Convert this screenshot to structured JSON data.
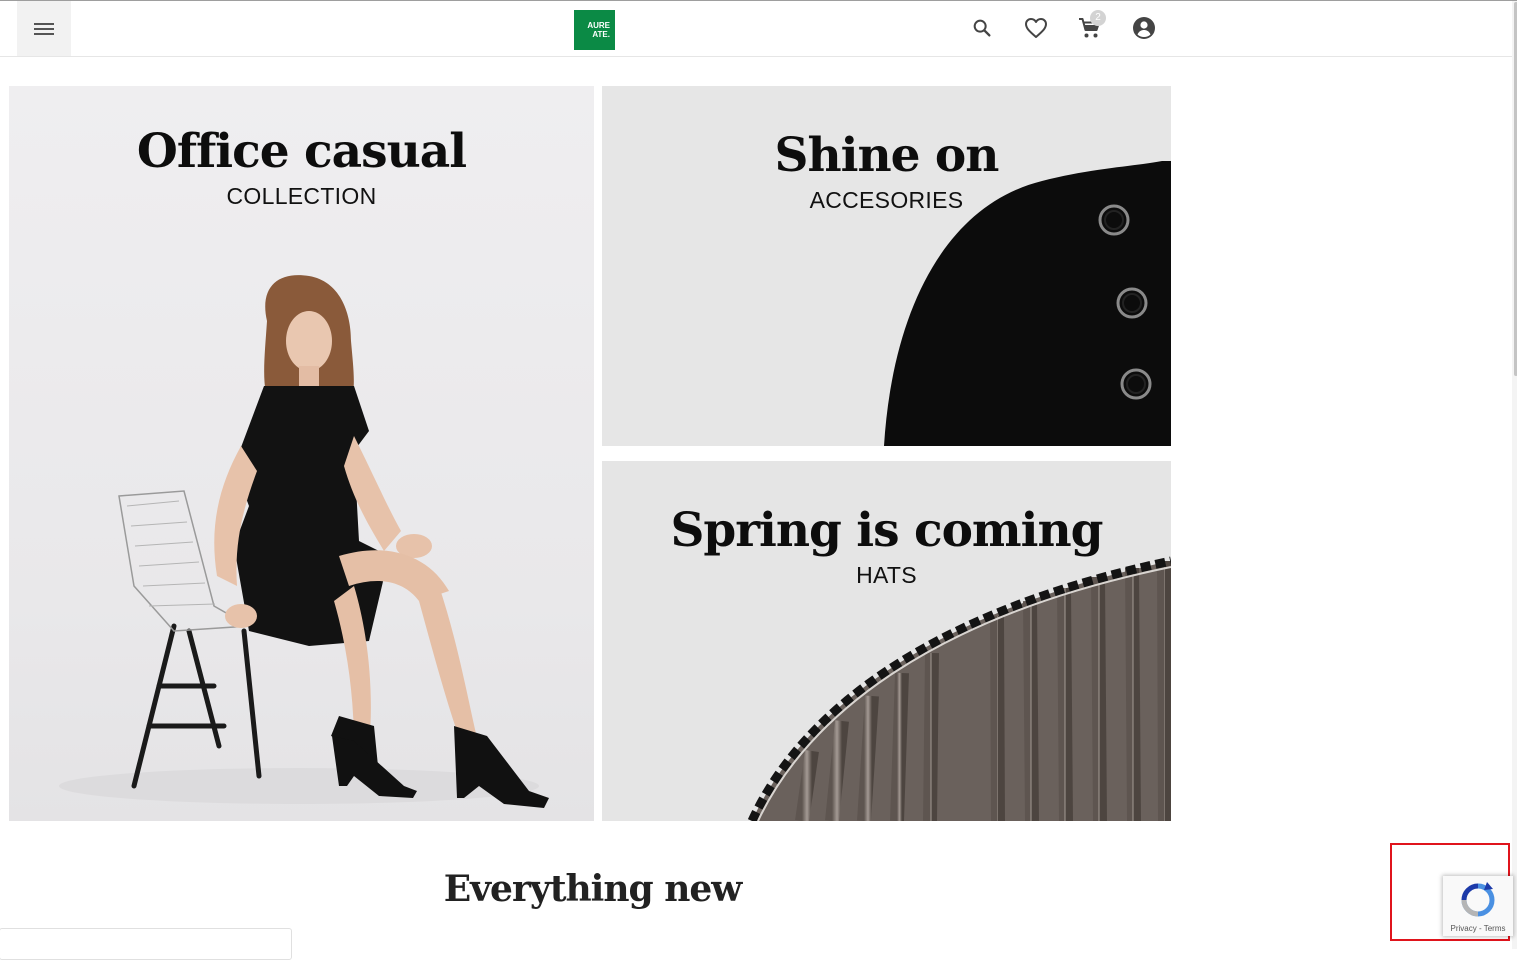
{
  "header": {
    "logo_line1": "AURE",
    "logo_line2": "ATE.",
    "cart_count": "2",
    "icons": [
      "menu-icon",
      "search-icon",
      "heart-icon",
      "cart-icon",
      "account-icon"
    ]
  },
  "banners": [
    {
      "title": "Office casual",
      "subtitle": "COLLECTION"
    },
    {
      "title": "Shine on",
      "subtitle": "ACCESORIES"
    },
    {
      "title": "Spring is coming",
      "subtitle": "HATS"
    }
  ],
  "section": {
    "title": "Everything new"
  },
  "recaptcha": {
    "privacy": "Privacy",
    "separator": " - ",
    "terms": "Terms"
  },
  "colors": {
    "brand": "#0b8a45",
    "text": "#0d0d0d",
    "highlight": "#e0141c"
  }
}
